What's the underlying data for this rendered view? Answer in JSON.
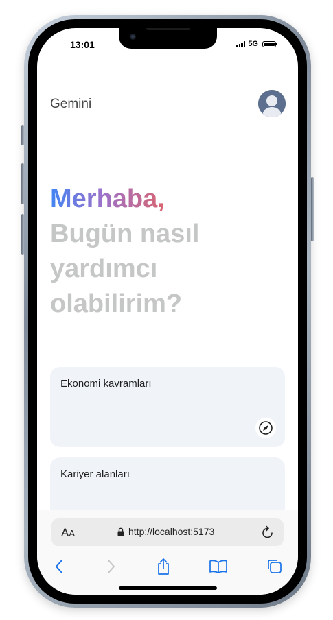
{
  "status_bar": {
    "time": "13:01",
    "network": "5G"
  },
  "header": {
    "app_title": "Gemini",
    "avatar_icon": "user-avatar-icon"
  },
  "greeting": {
    "hello": "Merhaba,",
    "line1": "Bugün nasıl",
    "line2": "yardımcı",
    "line3": "olabilirim?"
  },
  "suggestions": [
    {
      "label": "Ekonomi kavramları",
      "icon": "compass-icon"
    },
    {
      "label": "Kariyer alanları"
    }
  ],
  "browser": {
    "text_size_label": "AA",
    "url": "http://localhost:5173",
    "lock_icon": "lock-icon",
    "reload_icon": "reload-icon",
    "toolbar": [
      "back-icon",
      "forward-icon",
      "share-icon",
      "bookmarks-icon",
      "tabs-icon"
    ]
  },
  "colors": {
    "greeting_gradient": [
      "#4285f4",
      "#9b72cb",
      "#d96570"
    ],
    "subtitle": "#c4c7c5",
    "card_bg": "#f0f4f9",
    "ios_accent": "#1a73e8"
  }
}
